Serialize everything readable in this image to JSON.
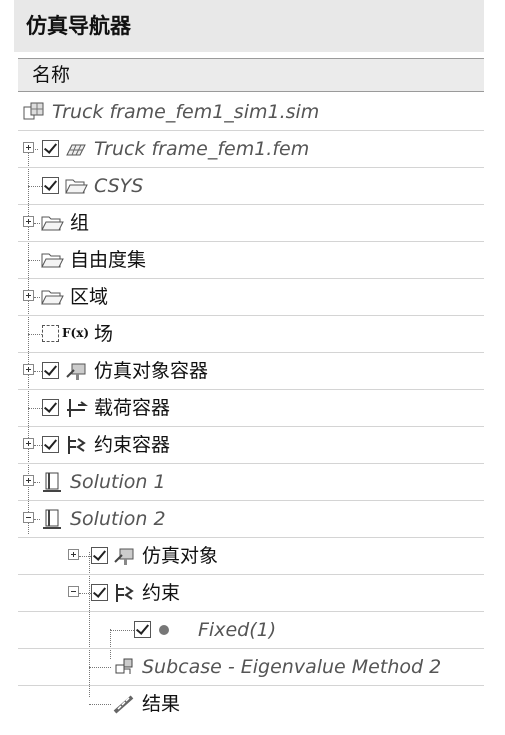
{
  "panel": {
    "title": "仿真导航器",
    "column_header": "名称"
  },
  "tree": {
    "root_label": "Truck frame_fem1_sim1.sim",
    "fem_label": "Truck frame_fem1.fem",
    "csys_label": "CSYS",
    "groups_label": "组",
    "dof_label": "自由度集",
    "regions_label": "区域",
    "fields_label": "场",
    "fields_icon_text": "F(x)",
    "sim_objects_container_label": "仿真对象容器",
    "load_container_label": "载荷容器",
    "constraint_container_label": "约束容器",
    "solution1_label": "Solution 1",
    "solution2_label": "Solution 2",
    "sim_objects_label": "仿真对象",
    "constraints_label": "约束",
    "fixed_label": "Fixed(1)",
    "subcase_label": "Subcase - Eigenvalue Method 2",
    "results_label": "结果"
  }
}
